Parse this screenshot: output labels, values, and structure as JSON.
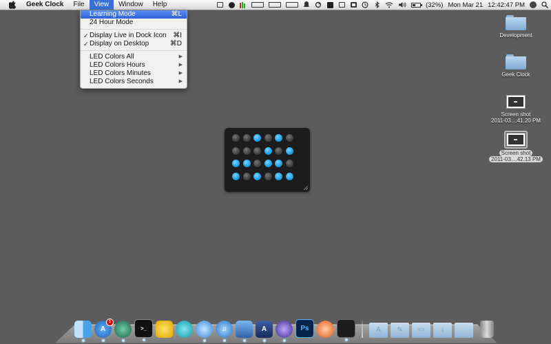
{
  "menubar": {
    "app_name": "Geek Clock",
    "menus": [
      "File",
      "View",
      "Window",
      "Help"
    ],
    "open_menu": "View",
    "battery_percent": "(32%)",
    "date": "Mon Mar 21",
    "time": "12:42:47 PM"
  },
  "view_menu": {
    "items": [
      {
        "label": "Learning Mode",
        "shortcut": "⌘L",
        "highlighted": true
      },
      {
        "label": "24 Hour Mode"
      },
      {
        "label": "Display Live in Dock Icon",
        "shortcut": "⌘I",
        "checked": true
      },
      {
        "label": "Display on Desktop",
        "shortcut": "⌘D",
        "checked": true
      },
      {
        "label": "LED Colors All",
        "submenu": true
      },
      {
        "label": "LED Colors Hours",
        "submenu": true
      },
      {
        "label": "LED Colors Minutes",
        "submenu": true
      },
      {
        "label": "LED Colors Seconds",
        "submenu": true
      }
    ]
  },
  "desktop_icons": [
    {
      "label": "Development",
      "kind": "folder"
    },
    {
      "label": "Geek Clock",
      "kind": "folder"
    },
    {
      "label_line1": "Screen shot",
      "label_line2": "2011-03....41.20 PM",
      "kind": "screenshot"
    },
    {
      "label_line1": "Screen shot",
      "label_line2": "2011-03....42.13 PM",
      "kind": "screenshot",
      "selected": true
    }
  ],
  "clock": {
    "led_on_color": "#2aa6ec",
    "led_off_color": "#4a4a4a",
    "columns": [
      [
        0,
        0,
        1,
        1
      ],
      [
        0,
        0,
        1,
        0
      ],
      [
        1,
        0,
        0,
        1
      ],
      [
        0,
        1,
        1,
        0
      ],
      [
        1,
        0,
        1,
        1
      ],
      [
        0,
        1,
        0,
        1
      ]
    ]
  },
  "dock": {
    "apps": [
      {
        "name": "finder-icon"
      },
      {
        "name": "app-store-icon",
        "badge": "1"
      },
      {
        "name": "time-machine-icon"
      },
      {
        "name": "terminal-icon"
      },
      {
        "name": "yellow-app-icon"
      },
      {
        "name": "cyan-app-icon"
      },
      {
        "name": "safari-icon"
      },
      {
        "name": "itunes-icon"
      },
      {
        "name": "xcode-icon"
      },
      {
        "name": "instruments-icon"
      },
      {
        "name": "eclipse-icon"
      },
      {
        "name": "photoshop-icon",
        "text": "Ps"
      },
      {
        "name": "dvd-player-icon"
      },
      {
        "name": "geek-clock-dock-icon"
      }
    ],
    "stacks": [
      "applications-stack",
      "utilities-stack",
      "documents-stack",
      "downloads-stack",
      "folder-stack"
    ]
  }
}
